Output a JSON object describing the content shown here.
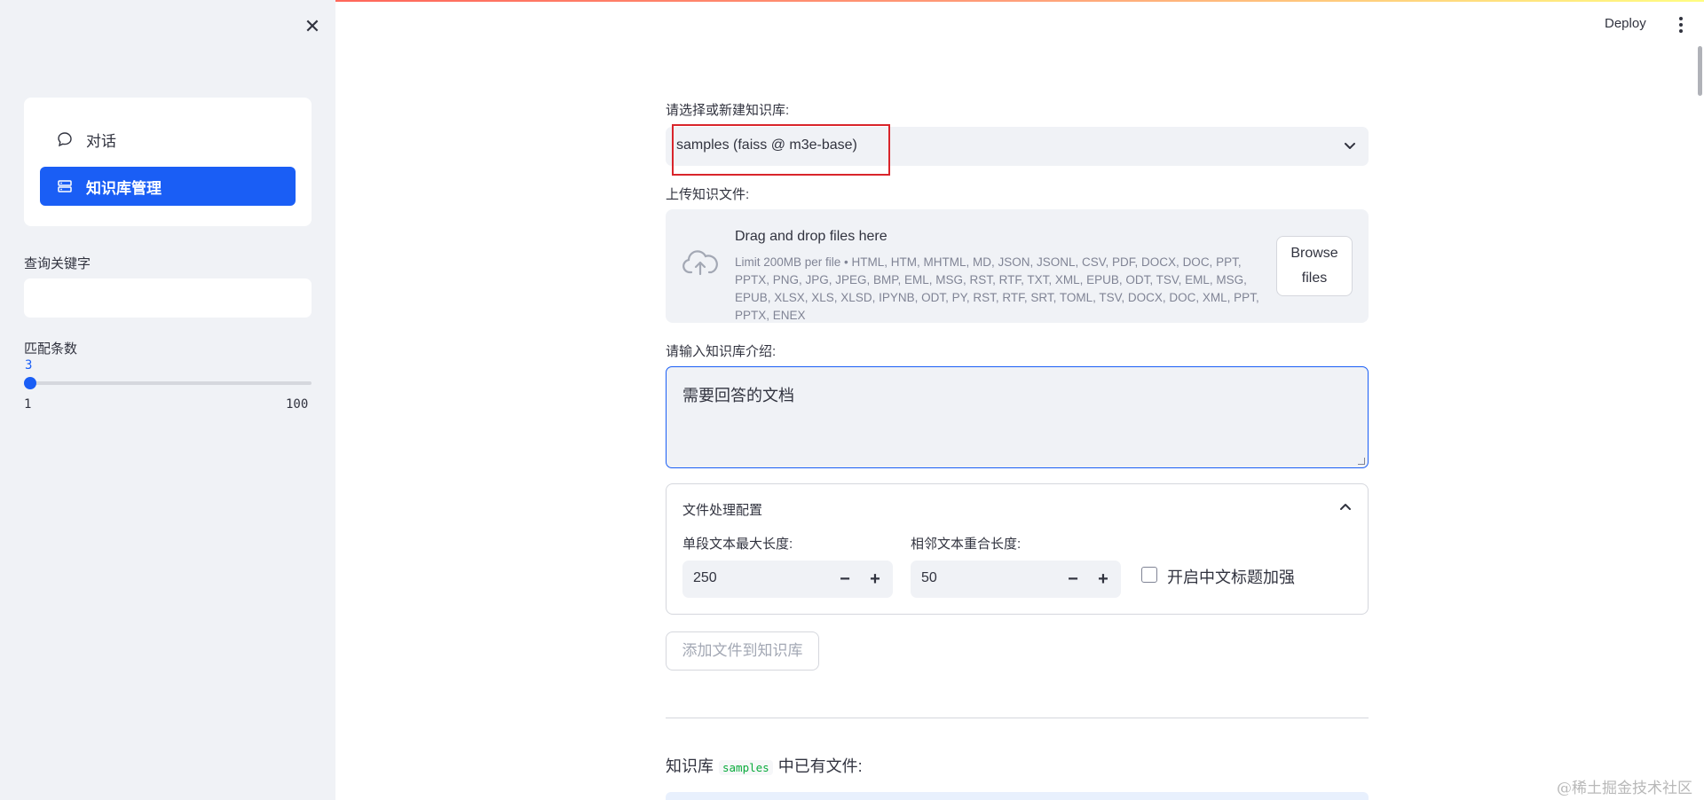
{
  "sidebar": {
    "close_icon": "close-icon",
    "menu": [
      {
        "label": "对话",
        "icon": "chat-bubble-icon",
        "active": false
      },
      {
        "label": "知识库管理",
        "icon": "database-icon",
        "active": true
      }
    ],
    "keyword_label": "查询关键字",
    "keyword_value": "",
    "match_count": {
      "label": "匹配条数",
      "value": "3",
      "min": "1",
      "max": "100",
      "fraction": 0.0
    }
  },
  "header": {
    "deploy_label": "Deploy",
    "menu_icon": "kebab-menu-icon"
  },
  "main": {
    "select_kb": {
      "label": "请选择或新建知识库:",
      "value": "samples (faiss @ m3e-base)"
    },
    "upload": {
      "label": "上传知识文件:",
      "title": "Drag and drop files here",
      "limit": "Limit 200MB per file • HTML, HTM, MHTML, MD, JSON, JSONL, CSV, PDF, DOCX, DOC, PPT, PPTX, PNG, JPG, JPEG, BMP, EML, MSG, RST, RTF, TXT, XML, EPUB, ODT, TSV, EML, MSG, EPUB, XLSX, XLS, XLSD, IPYNB, ODT, PY, RST, RTF, SRT, TOML, TSV, DOCX, DOC, XML, PPT, PPTX, ENEX",
      "browse_label": "Browse files"
    },
    "intro": {
      "label": "请输入知识库介绍:",
      "value": "需要回答的文档"
    },
    "config": {
      "title": "文件处理配置",
      "chunk_size_label": "单段文本最大长度:",
      "chunk_size_value": "250",
      "overlap_label": "相邻文本重合长度:",
      "overlap_value": "50",
      "zh_title_label": "开启中文标题加强",
      "zh_title_checked": false
    },
    "add_button_label": "添加文件到知识库",
    "kb_files": {
      "prefix": "知识库",
      "name": "samples",
      "suffix": "中已有文件:"
    }
  },
  "watermark": "@稀土掘金技术社区",
  "colors": {
    "accent": "#1a5ef5",
    "sidebar_bg": "#f0f2f6",
    "highlight_box": "#d9252b"
  }
}
